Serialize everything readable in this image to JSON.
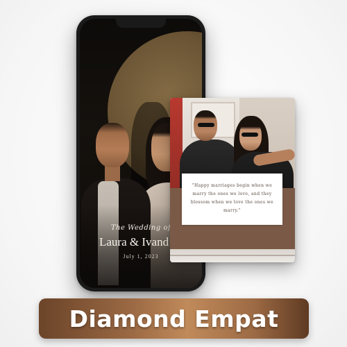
{
  "phone_screen": {
    "wedding_title": "The Wedding of",
    "couple_names": "Laura & Ivand",
    "date": "July 1, 2023"
  },
  "card": {
    "quote": "\"Happy marriages begin when we marry the ones we love, and they blossom when we love the ones we marry.\""
  },
  "banner": {
    "label": "Diamond Empat"
  },
  "colors": {
    "banner_gradient_dark": "#6b4429",
    "banner_gradient_light": "#c08a5a",
    "card_accent_brown": "#7a5a46",
    "phone_body": "#1a1a1a"
  }
}
